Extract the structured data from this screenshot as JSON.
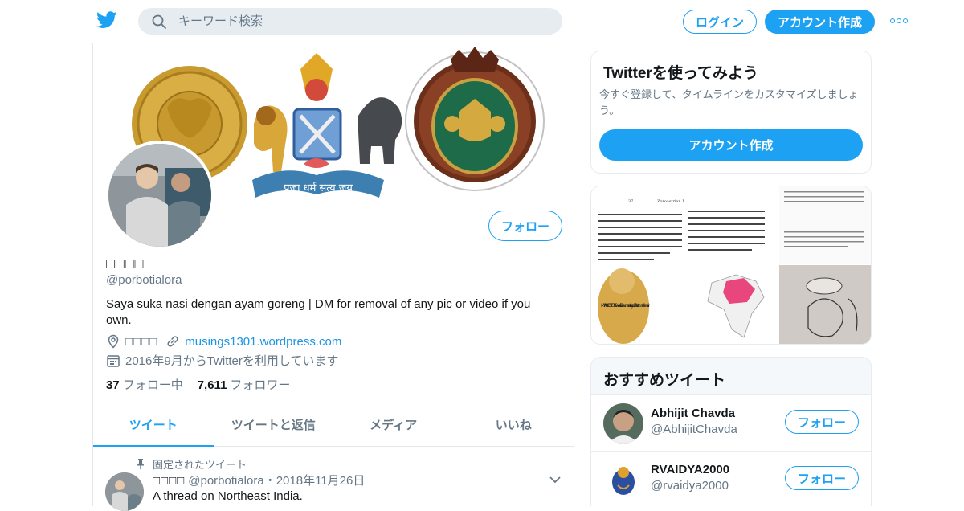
{
  "header": {
    "search_placeholder": "キーワード検索",
    "login_label": "ログイン",
    "signup_label": "アカウント作成"
  },
  "profile": {
    "display_name": "□□□□",
    "handle": "@porbotialora",
    "follow_label": "フォロー",
    "bio": "Saya suka nasi dengan ayam goreng | DM for removal of any pic or video if you own.",
    "location": "□□□□",
    "website": "musings1301.wordpress.com",
    "joined": "2016年9月からTwitterを利用しています",
    "following_count": "37",
    "following_label": "フォロー中",
    "followers_count": "7,611",
    "followers_label": "フォロワー",
    "banner_text": "प्रजा धर्म सत्य जय"
  },
  "tabs": [
    {
      "label": "ツイート"
    },
    {
      "label": "ツイートと返信"
    },
    {
      "label": "メディア"
    },
    {
      "label": "いいね"
    }
  ],
  "tweet": {
    "pinned_label": "固定されたツイート",
    "author": "□□□□",
    "handle_date": "@porbotialora・2018年11月26日",
    "text": "A thread on Northeast India."
  },
  "signup_card": {
    "title": "Twitterを使ってみよう",
    "description": "今すぐ登録して、タイムラインをカスタマイズしましょう。",
    "button_label": "アカウント作成"
  },
  "media_card": {
    "page_number": "37",
    "heading": "Zoroastrian I",
    "meme_text": "MY ANCESTORS we sacrifice humans to goddess Kamateshwari"
  },
  "recommended": {
    "title": "おすすめツイート",
    "accounts": [
      {
        "name": "Abhijit Chavda",
        "handle": "@AbhijitChavda",
        "button_label": "フォロー"
      },
      {
        "name": "RVAIDYA2000",
        "handle": "@rvaidya2000",
        "button_label": "フォロー"
      }
    ]
  },
  "colors": {
    "accent": "#1da1f2",
    "text_secondary": "#657786",
    "border": "#e1e8ed"
  }
}
